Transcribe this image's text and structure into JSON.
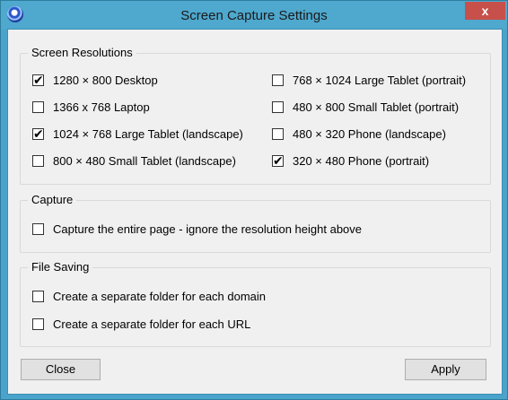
{
  "window": {
    "title": "Screen Capture Settings",
    "close_glyph": "x"
  },
  "resolutions": {
    "legend": "Screen Resolutions",
    "left": [
      {
        "label": "1280 × 800 Desktop",
        "checked": true
      },
      {
        "label": "1366 x 768 Laptop",
        "checked": false
      },
      {
        "label": "1024 × 768 Large Tablet (landscape)",
        "checked": true
      },
      {
        "label": "800 × 480 Small Tablet (landscape)",
        "checked": false
      }
    ],
    "right": [
      {
        "label": "768 × 1024 Large Tablet (portrait)",
        "checked": false
      },
      {
        "label": "480 × 800 Small Tablet (portrait)",
        "checked": false
      },
      {
        "label": "480 × 320 Phone (landscape)",
        "checked": false
      },
      {
        "label": "320 × 480 Phone (portrait)",
        "checked": true
      }
    ]
  },
  "capture": {
    "legend": "Capture",
    "options": [
      {
        "label": "Capture the entire page - ignore the resolution height above",
        "checked": false
      }
    ]
  },
  "file_saving": {
    "legend": "File Saving",
    "options": [
      {
        "label": "Create a separate folder for each domain",
        "checked": false
      },
      {
        "label": "Create a separate folder for each URL",
        "checked": false
      }
    ]
  },
  "buttons": {
    "close": "Close",
    "apply": "Apply"
  },
  "check_glyph": "✔"
}
